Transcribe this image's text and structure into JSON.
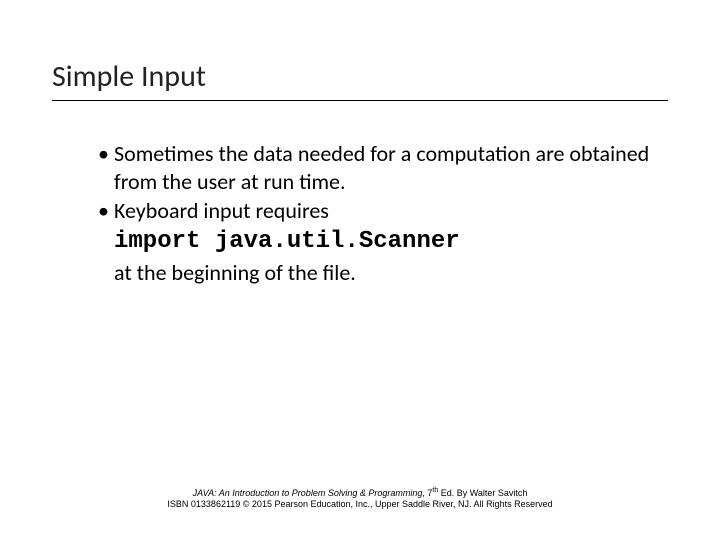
{
  "title": "Simple Input",
  "bullets": {
    "b1": "Sometimes the data needed for a computation are obtained from the user at run time.",
    "b2": "Keyboard input requires",
    "code": "import java.util.Scanner",
    "b2_cont": "at the beginning of the file."
  },
  "footer": {
    "book_title": "JAVA: An Introduction to Problem Solving & Programming",
    "edition_prefix": ", 7",
    "edition_suffix": " Ed. By Walter Savitch",
    "line2": "ISBN 0133862119 © 2015 Pearson Education, Inc., Upper Saddle River, NJ. All Rights Reserved"
  }
}
